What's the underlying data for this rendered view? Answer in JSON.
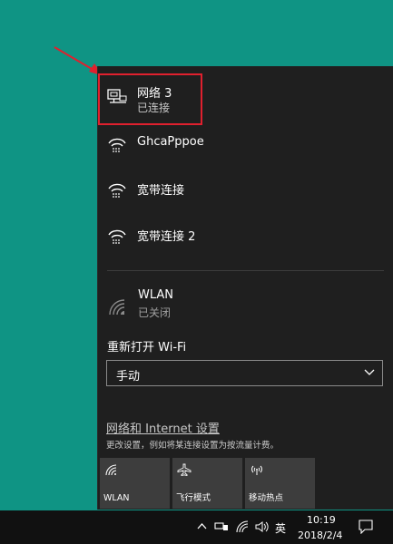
{
  "networks": [
    {
      "name": "网络 3",
      "status": "已连接",
      "icon": "wired-ethernet-icon"
    },
    {
      "name": "GhcaPppoe",
      "icon": "dialup-broadband-icon"
    },
    {
      "name": "宽带连接",
      "icon": "dialup-broadband-icon"
    },
    {
      "name": "宽带连接 2",
      "icon": "dialup-broadband-icon"
    }
  ],
  "wlan": {
    "name": "WLAN",
    "status": "已关闭",
    "icon": "wifi-off-icon"
  },
  "wifi_reopen": {
    "label": "重新打开 Wi-Fi",
    "selected": "手动"
  },
  "settings": {
    "link": "网络和 Internet 设置",
    "description": "更改设置，例如将某连接设置为按流量计费。"
  },
  "quick_actions": [
    {
      "label": "WLAN",
      "icon": "wifi-icon"
    },
    {
      "label": "飞行模式",
      "icon": "airplane-icon"
    },
    {
      "label": "移动热点",
      "icon": "hotspot-icon"
    }
  ],
  "taskbar": {
    "ime": "英",
    "time": "10:19",
    "date": "2018/2/4"
  },
  "colors": {
    "desktop": "#0f9484",
    "flyout": "#1f1f1f",
    "tile": "#3d3d3d",
    "highlight": "#e0202e"
  }
}
